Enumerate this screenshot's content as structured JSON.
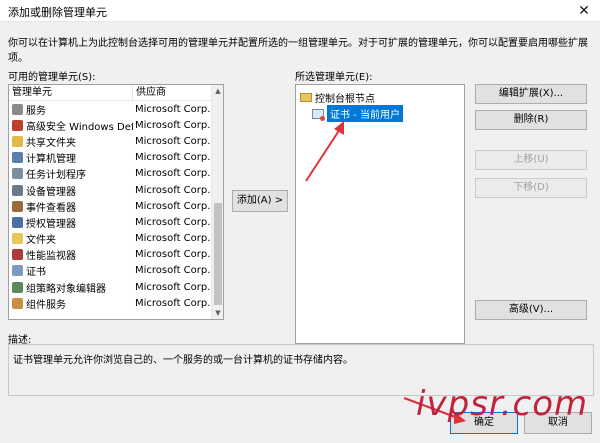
{
  "window": {
    "title": "添加或删除管理单元",
    "close_glyph": "✕"
  },
  "intro_text": "你可以在计算机上为此控制台选择可用的管理单元并配置所选的一组管理单元。对于可扩展的管理单元，你可以配置要启用哪些扩展项。",
  "available": {
    "label": "可用的管理单元(S):",
    "col_name": "管理单元",
    "col_vendor": "供应商",
    "items": [
      {
        "name": "服务",
        "vendor": "Microsoft Corp...",
        "icon": "gear-icon",
        "color": "#8a8a8a"
      },
      {
        "name": "高级安全 Windows Def...",
        "vendor": "Microsoft Corp...",
        "icon": "firewall-icon",
        "color": "#b9412e"
      },
      {
        "name": "共享文件夹",
        "vendor": "Microsoft Corp...",
        "icon": "folder-share-icon",
        "color": "#e3b94c"
      },
      {
        "name": "计算机管理",
        "vendor": "Microsoft Corp...",
        "icon": "computer-icon",
        "color": "#5b7fa8"
      },
      {
        "name": "任务计划程序",
        "vendor": "Microsoft Corp...",
        "icon": "clock-icon",
        "color": "#7b8fa0"
      },
      {
        "name": "设备管理器",
        "vendor": "Microsoft Corp...",
        "icon": "device-icon",
        "color": "#6a7a8a"
      },
      {
        "name": "事件查看器",
        "vendor": "Microsoft Corp...",
        "icon": "event-log-icon",
        "color": "#9a6a3a"
      },
      {
        "name": "授权管理器",
        "vendor": "Microsoft Corp...",
        "icon": "auth-icon",
        "color": "#4a6fa0"
      },
      {
        "name": "文件夹",
        "vendor": "Microsoft Corp...",
        "icon": "folder-icon",
        "color": "#e7c65a"
      },
      {
        "name": "性能监视器",
        "vendor": "Microsoft Corp...",
        "icon": "monitor-icon",
        "color": "#b03a3a"
      },
      {
        "name": "证书",
        "vendor": "Microsoft Corp...",
        "icon": "certificate-icon",
        "color": "#7a9ac0"
      },
      {
        "name": "组策略对象编辑器",
        "vendor": "Microsoft Corp...",
        "icon": "policy-icon",
        "color": "#5a8a5a"
      },
      {
        "name": "组件服务",
        "vendor": "Microsoft Corp...",
        "icon": "components-icon",
        "color": "#c89040"
      }
    ]
  },
  "add_button": "添加(A) >",
  "selected": {
    "label": "所选管理单元(E):",
    "root": "控制台根节点",
    "child": "证书 - 当前用户"
  },
  "buttons": {
    "edit_extensions": "编辑扩展(X)...",
    "remove": "删除(R)",
    "move_up": "上移(U)",
    "move_down": "下移(D)",
    "advanced": "高级(V)...",
    "ok": "确定",
    "cancel": "取消"
  },
  "description": {
    "label": "描述:",
    "text": "证书管理单元允许你浏览自己的、一个服务的或一台计算机的证书存储内容。"
  },
  "watermark": "ivpsr.com",
  "colors": {
    "accent": "#0078d7",
    "annotation_red": "#e0303a"
  }
}
